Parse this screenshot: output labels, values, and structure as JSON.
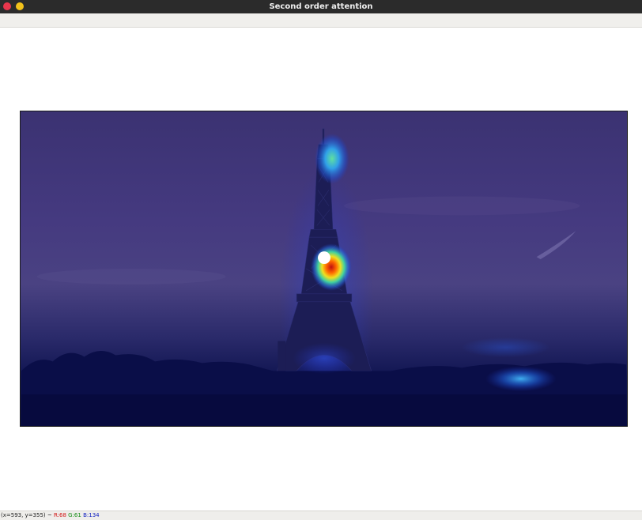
{
  "window": {
    "title": "Second order attention"
  },
  "status": {
    "coords": "(x=593, y=355) ~",
    "r_label": "R:68",
    "g_label": "G:61",
    "b_label": "B:134"
  },
  "colors": {
    "close": "#e8364c",
    "minimize": "#f2c21b",
    "titlebar": "#2b2b2b"
  },
  "image": {
    "subject": "eiffel-tower-at-dusk",
    "overlay": "attention-heatmap"
  }
}
